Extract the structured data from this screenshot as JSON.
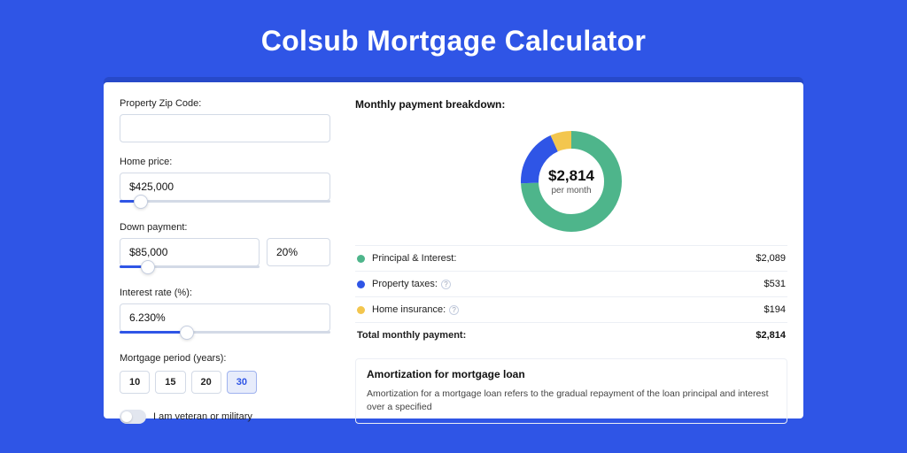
{
  "hero": {
    "title": "Colsub Mortgage Calculator"
  },
  "form": {
    "zip_label": "Property Zip Code:",
    "zip_value": "",
    "home_price_label": "Home price:",
    "home_price_value": "$425,000",
    "home_price_slider_pct": 10,
    "down_payment_label": "Down payment:",
    "down_payment_value": "$85,000",
    "down_payment_pct_value": "20%",
    "down_payment_slider_pct": 20,
    "interest_label": "Interest rate (%):",
    "interest_value": "6.230%",
    "interest_slider_pct": 32,
    "period_label": "Mortgage period (years):",
    "periods": [
      "10",
      "15",
      "20",
      "30"
    ],
    "period_active_index": 3,
    "veteran_label": "I am veteran or military",
    "veteran_on": false
  },
  "breakdown": {
    "title": "Monthly payment breakdown:",
    "donut_amount": "$2,814",
    "donut_sub": "per month",
    "rows": [
      {
        "label": "Principal & Interest:",
        "value": "$2,089",
        "color": "#4eb58b",
        "info": false
      },
      {
        "label": "Property taxes:",
        "value": "$531",
        "color": "#2f55e6",
        "info": true
      },
      {
        "label": "Home insurance:",
        "value": "$194",
        "color": "#f3c64e",
        "info": true
      }
    ],
    "total_label": "Total monthly payment:",
    "total_value": "$2,814"
  },
  "chart_data": {
    "type": "pie",
    "title": "Monthly payment breakdown",
    "series": [
      {
        "name": "Principal & Interest",
        "value": 2089,
        "color": "#4eb58b"
      },
      {
        "name": "Property taxes",
        "value": 531,
        "color": "#2f55e6"
      },
      {
        "name": "Home insurance",
        "value": 194,
        "color": "#f3c64e"
      }
    ],
    "total": 2814,
    "center_label": "$2,814",
    "center_sublabel": "per month"
  },
  "amort": {
    "title": "Amortization for mortgage loan",
    "body": "Amortization for a mortgage loan refers to the gradual repayment of the loan principal and interest over a specified"
  }
}
